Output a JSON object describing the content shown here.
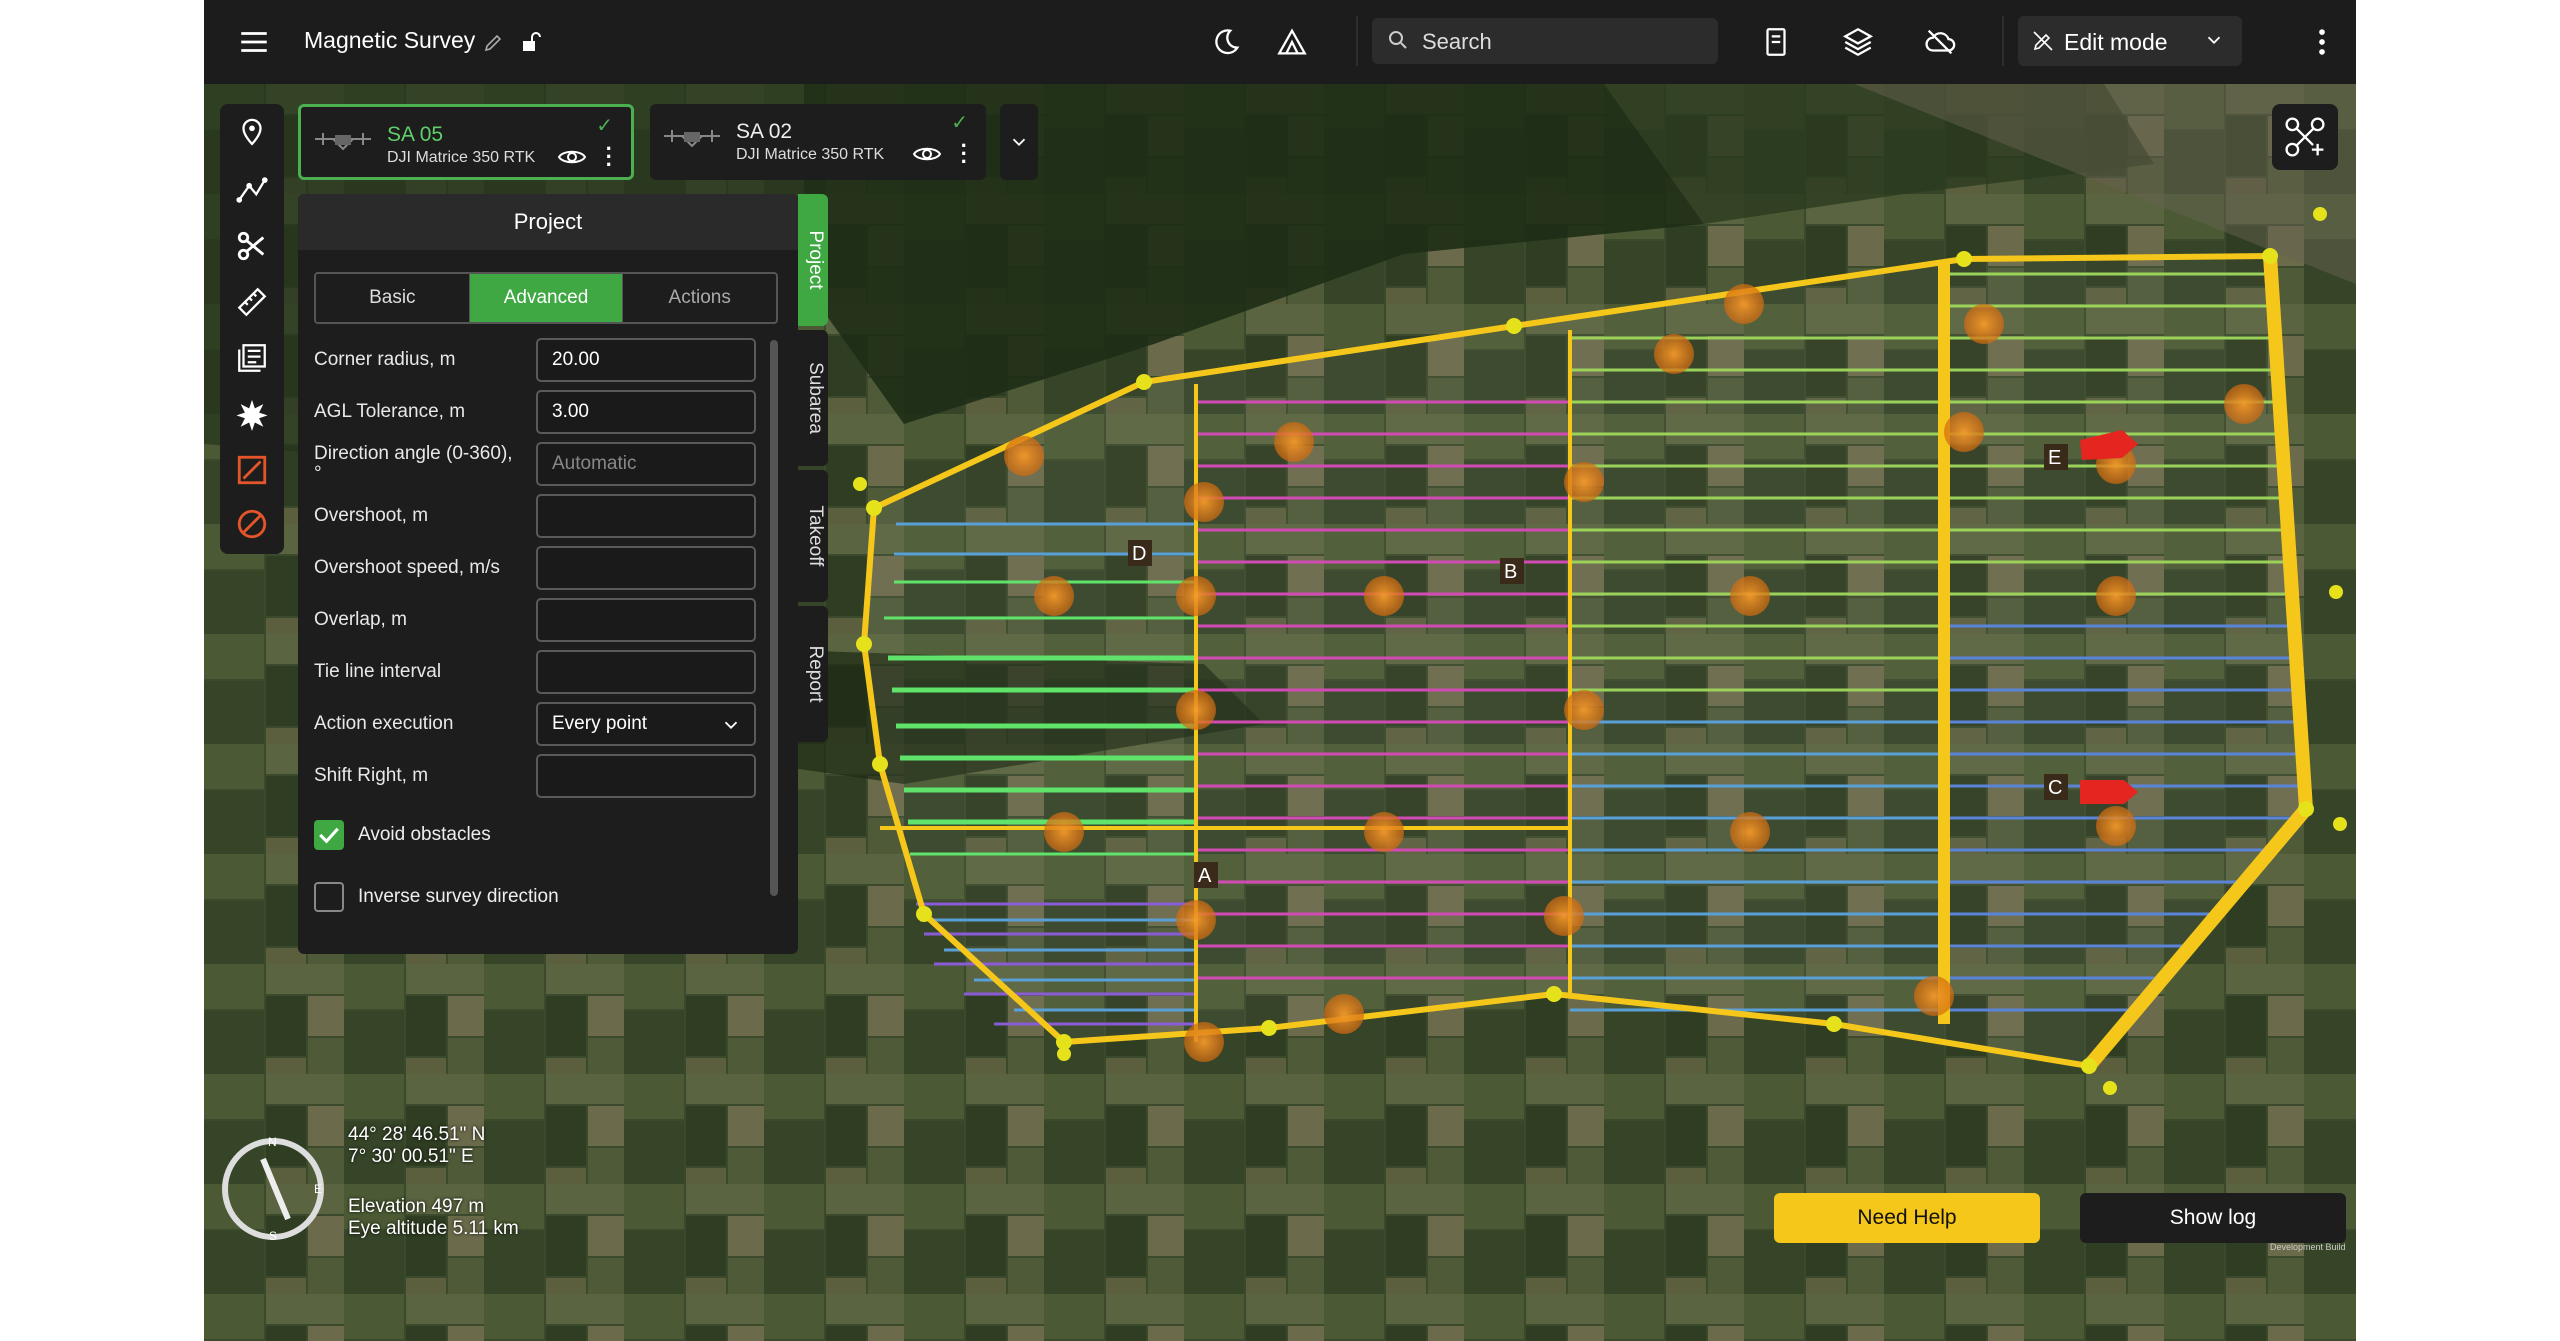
{
  "app": {
    "title": "Magnetic Survey"
  },
  "search": {
    "placeholder": "Search"
  },
  "mode": {
    "label": "Edit mode"
  },
  "drones": [
    {
      "name": "SA 05",
      "model": "DJI Matrice 350 RTK"
    },
    {
      "name": "SA 02",
      "model": "DJI Matrice 350 RTK"
    }
  ],
  "panel": {
    "title": "Project",
    "tabs": [
      "Basic",
      "Advanced",
      "Actions"
    ],
    "fields": [
      {
        "label": "Corner radius, m",
        "value": "20.00",
        "placeholder": ""
      },
      {
        "label": "AGL Tolerance, m",
        "value": "3.00",
        "placeholder": ""
      },
      {
        "label": "Direction angle (0-360), °",
        "value": "",
        "placeholder": "Automatic"
      },
      {
        "label": "Overshoot, m",
        "value": "",
        "placeholder": ""
      },
      {
        "label": "Overshoot speed, m/s",
        "value": "",
        "placeholder": ""
      },
      {
        "label": "Overlap, m",
        "value": "",
        "placeholder": ""
      },
      {
        "label": "Tie line interval",
        "value": "",
        "placeholder": ""
      },
      {
        "label": "Action execution",
        "value": "Every point",
        "placeholder": ""
      },
      {
        "label": "Shift Right, m",
        "value": "",
        "placeholder": ""
      }
    ],
    "avoid_obstacles": {
      "label": "Avoid obstacles",
      "checked": true
    },
    "inverse_survey": {
      "label": "Inverse survey direction",
      "checked": false
    },
    "side_tabs": [
      "Project",
      "Subarea",
      "Takeoff",
      "Report"
    ]
  },
  "map": {
    "markers": [
      "A",
      "B",
      "C",
      "D",
      "E"
    ],
    "coords": {
      "lat": "44° 28' 46.51\" N",
      "lon": "7° 30' 00.51\" E"
    },
    "elevation": "Elevation 497 m",
    "eye_altitude": "Eye altitude 5.11 km",
    "compass": {
      "n": "N",
      "e": "E",
      "s": "S"
    }
  },
  "footer": {
    "need_help": "Need Help",
    "show_log": "Show log",
    "dev_build": "Development Build"
  },
  "colors": {
    "accent": "#3fa843",
    "boundary": "#f5c71a",
    "help": "#f5c71a"
  }
}
